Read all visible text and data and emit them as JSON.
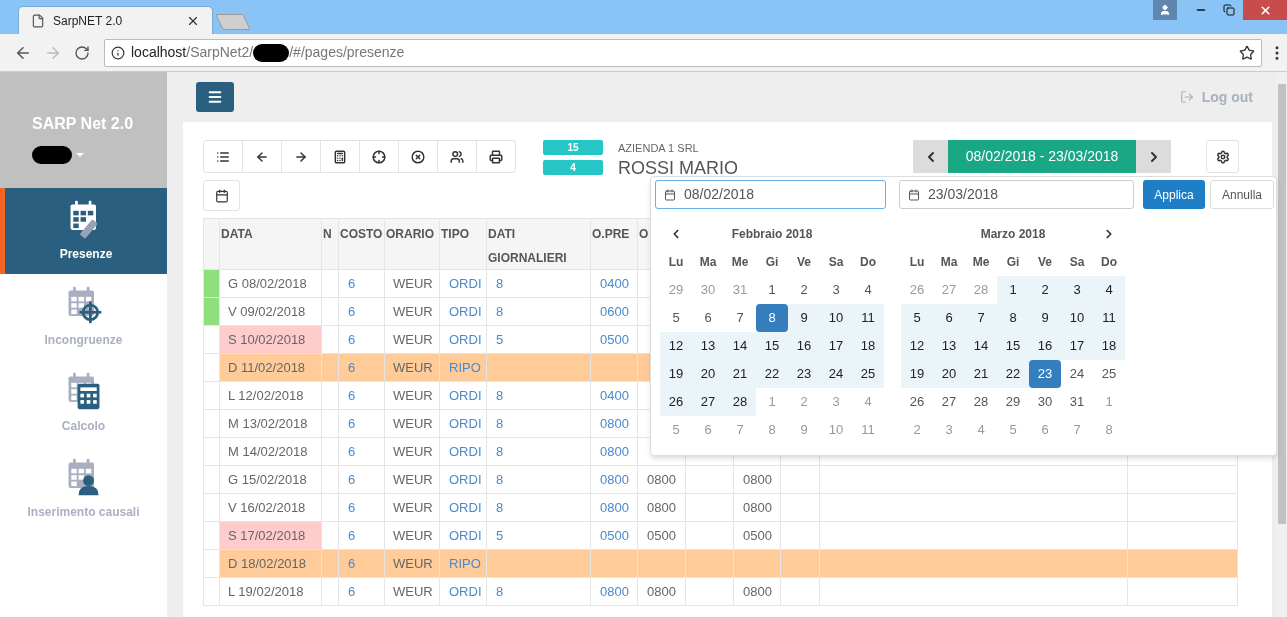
{
  "browser": {
    "tab_title": "SarpNET 2.0",
    "url_host": "localhost",
    "url_path": "/SarpNet2/",
    "url_rest": "/#/pages/presenze"
  },
  "header": {
    "logout": "Log out"
  },
  "sidebar": {
    "app_title": "SARP Net 2.0",
    "items": [
      {
        "label": "Presenze",
        "kind": "pencil",
        "selected": true
      },
      {
        "label": "Incongruenze",
        "kind": "target",
        "selected": false
      },
      {
        "label": "Calcolo",
        "kind": "calculator",
        "selected": false
      },
      {
        "label": "Inserimento causali",
        "kind": "person",
        "selected": false
      }
    ]
  },
  "toolbar": {
    "buttons": [
      {
        "kind": "list"
      },
      {
        "kind": "back"
      },
      {
        "kind": "forward"
      },
      {
        "kind": "calculator"
      },
      {
        "kind": "crosshair"
      },
      {
        "kind": "remove"
      },
      {
        "kind": "users"
      },
      {
        "kind": "print"
      }
    ],
    "extra_button": {
      "kind": "calendar"
    }
  },
  "badges": [
    "15",
    "4"
  ],
  "company": "AZIENDA 1 SRL",
  "employee": "ROSSI MARIO",
  "period": {
    "label": "08/02/2018 - 23/03/2018"
  },
  "table": {
    "columns": [
      "DATA",
      "N",
      "COSTO",
      "ORARIO",
      "TIPO",
      "DATI GIORNALIERI",
      "O.PRE",
      "O"
    ],
    "rows": [
      {
        "marked": true,
        "kind": "weekday",
        "date": "G 08/02/2018",
        "costo": "6",
        "orario": "WEUR",
        "tipo": "ORDI",
        "dati": "8",
        "o_pre": "0400"
      },
      {
        "marked": true,
        "kind": "weekday",
        "date": "V 09/02/2018",
        "costo": "6",
        "orario": "WEUR",
        "tipo": "ORDI",
        "dati": "8",
        "o_pre": "0600"
      },
      {
        "marked": false,
        "kind": "saturday",
        "date": "S 10/02/2018",
        "costo": "6",
        "orario": "WEUR",
        "tipo": "ORDI",
        "dati": "5",
        "o_pre": "0500"
      },
      {
        "marked": false,
        "kind": "sunday",
        "date": "D 11/02/2018",
        "costo": "6",
        "orario": "WEUR",
        "tipo": "RIPO"
      },
      {
        "marked": false,
        "kind": "weekday",
        "date": "L 12/02/2018",
        "costo": "6",
        "orario": "WEUR",
        "tipo": "ORDI",
        "dati": "8",
        "o_pre": "0400"
      },
      {
        "marked": false,
        "kind": "weekday",
        "date": "M 13/02/2018",
        "costo": "6",
        "orario": "WEUR",
        "tipo": "ORDI",
        "dati": "8",
        "o_pre": "0800"
      },
      {
        "marked": false,
        "kind": "weekday",
        "date": "M 14/02/2018",
        "costo": "6",
        "orario": "WEUR",
        "tipo": "ORDI",
        "dati": "8",
        "o_pre": "0800"
      },
      {
        "marked": false,
        "kind": "weekday",
        "date": "G 15/02/2018",
        "costo": "6",
        "orario": "WEUR",
        "tipo": "ORDI",
        "dati": "8",
        "o_pre": "0800",
        "column_9": "0800",
        "column_11": "0800"
      },
      {
        "marked": false,
        "kind": "weekday",
        "date": "V 16/02/2018",
        "costo": "6",
        "orario": "WEUR",
        "tipo": "ORDI",
        "dati": "8",
        "o_pre": "0800",
        "column_9": "0800",
        "column_11": "0800"
      },
      {
        "marked": false,
        "kind": "saturday",
        "date": "S 17/02/2018",
        "costo": "6",
        "orario": "WEUR",
        "tipo": "ORDI",
        "dati": "5",
        "o_pre": "0500",
        "column_9": "0500",
        "column_11": "0500"
      },
      {
        "marked": false,
        "kind": "sunday",
        "date": "D 18/02/2018",
        "costo": "6",
        "orario": "WEUR",
        "tipo": "RIPO"
      },
      {
        "marked": false,
        "kind": "weekday",
        "date": "L 19/02/2018",
        "costo": "6",
        "orario": "WEUR",
        "tipo": "ORDI",
        "dati": "8",
        "o_pre": "0800",
        "column_9": "0800",
        "column_11": "0800"
      }
    ]
  },
  "date_picker": {
    "start": "08/02/2018",
    "start_focused": true,
    "end": "23/03/2018",
    "apply": "Applica",
    "cancel": "Annulla",
    "months": [
      {
        "title": "Febbraio 2018",
        "weekdays": [
          "Lu",
          "Ma",
          "Me",
          "Gi",
          "Ve",
          "Sa",
          "Do"
        ],
        "weeks": [
          [
            {
              "t": "29",
              "off": true,
              "in_range": false,
              "selected": false
            },
            {
              "t": "30",
              "off": true,
              "in_range": false,
              "selected": false
            },
            {
              "t": "31",
              "off": true,
              "in_range": false,
              "selected": false
            },
            {
              "t": "1",
              "off": false,
              "in_range": false,
              "selected": false
            },
            {
              "t": "2",
              "off": false,
              "in_range": false,
              "selected": false
            },
            {
              "t": "3",
              "off": false,
              "in_range": false,
              "selected": false
            },
            {
              "t": "4",
              "off": false,
              "in_range": false,
              "selected": false
            }
          ],
          [
            {
              "t": "5",
              "off": false,
              "in_range": false,
              "selected": false
            },
            {
              "t": "6",
              "off": false,
              "in_range": false,
              "selected": false
            },
            {
              "t": "7",
              "off": false,
              "in_range": false,
              "selected": false
            },
            {
              "t": "8",
              "off": false,
              "in_range": true,
              "selected": true
            },
            {
              "t": "9",
              "off": false,
              "in_range": true,
              "selected": false
            },
            {
              "t": "10",
              "off": false,
              "in_range": true,
              "selected": false
            },
            {
              "t": "11",
              "off": false,
              "in_range": true,
              "selected": false
            }
          ],
          [
            {
              "t": "12",
              "off": false,
              "in_range": true,
              "selected": false
            },
            {
              "t": "13",
              "off": false,
              "in_range": true,
              "selected": false
            },
            {
              "t": "14",
              "off": false,
              "in_range": true,
              "selected": false
            },
            {
              "t": "15",
              "off": false,
              "in_range": true,
              "selected": false
            },
            {
              "t": "16",
              "off": false,
              "in_range": true,
              "selected": false
            },
            {
              "t": "17",
              "off": false,
              "in_range": true,
              "selected": false
            },
            {
              "t": "18",
              "off": false,
              "in_range": true,
              "selected": false
            }
          ],
          [
            {
              "t": "19",
              "off": false,
              "in_range": true,
              "selected": false
            },
            {
              "t": "20",
              "off": false,
              "in_range": true,
              "selected": false
            },
            {
              "t": "21",
              "off": false,
              "in_range": true,
              "selected": false
            },
            {
              "t": "22",
              "off": false,
              "in_range": true,
              "selected": false
            },
            {
              "t": "23",
              "off": false,
              "in_range": true,
              "selected": false
            },
            {
              "t": "24",
              "off": false,
              "in_range": true,
              "selected": false
            },
            {
              "t": "25",
              "off": false,
              "in_range": true,
              "selected": false
            }
          ],
          [
            {
              "t": "26",
              "off": false,
              "in_range": true,
              "selected": false
            },
            {
              "t": "27",
              "off": false,
              "in_range": true,
              "selected": false
            },
            {
              "t": "28",
              "off": false,
              "in_range": true,
              "selected": false
            },
            {
              "t": "1",
              "off": true,
              "in_range": false,
              "selected": false
            },
            {
              "t": "2",
              "off": true,
              "in_range": false,
              "selected": false
            },
            {
              "t": "3",
              "off": true,
              "in_range": false,
              "selected": false
            },
            {
              "t": "4",
              "off": true,
              "in_range": false,
              "selected": false
            }
          ],
          [
            {
              "t": "5",
              "off": true,
              "in_range": false,
              "selected": false
            },
            {
              "t": "6",
              "off": true,
              "in_range": false,
              "selected": false
            },
            {
              "t": "7",
              "off": true,
              "in_range": false,
              "selected": false
            },
            {
              "t": "8",
              "off": true,
              "in_range": false,
              "selected": false
            },
            {
              "t": "9",
              "off": true,
              "in_range": false,
              "selected": false
            },
            {
              "t": "10",
              "off": true,
              "in_range": false,
              "selected": false
            },
            {
              "t": "11",
              "off": true,
              "in_range": false,
              "selected": false
            }
          ]
        ]
      },
      {
        "title": "Marzo 2018",
        "weekdays": [
          "Lu",
          "Ma",
          "Me",
          "Gi",
          "Ve",
          "Sa",
          "Do"
        ],
        "weeks": [
          [
            {
              "t": "26",
              "off": true,
              "in_range": false,
              "selected": false
            },
            {
              "t": "27",
              "off": true,
              "in_range": false,
              "selected": false
            },
            {
              "t": "28",
              "off": true,
              "in_range": false,
              "selected": false
            },
            {
              "t": "1",
              "off": false,
              "in_range": true,
              "selected": false
            },
            {
              "t": "2",
              "off": false,
              "in_range": true,
              "selected": false
            },
            {
              "t": "3",
              "off": false,
              "in_range": true,
              "selected": false
            },
            {
              "t": "4",
              "off": false,
              "in_range": true,
              "selected": false
            }
          ],
          [
            {
              "t": "5",
              "off": false,
              "in_range": true,
              "selected": false
            },
            {
              "t": "6",
              "off": false,
              "in_range": true,
              "selected": false
            },
            {
              "t": "7",
              "off": false,
              "in_range": true,
              "selected": false
            },
            {
              "t": "8",
              "off": false,
              "in_range": true,
              "selected": false
            },
            {
              "t": "9",
              "off": false,
              "in_range": true,
              "selected": false
            },
            {
              "t": "10",
              "off": false,
              "in_range": true,
              "selected": false
            },
            {
              "t": "11",
              "off": false,
              "in_range": true,
              "selected": false
            }
          ],
          [
            {
              "t": "12",
              "off": false,
              "in_range": true,
              "selected": false
            },
            {
              "t": "13",
              "off": false,
              "in_range": true,
              "selected": false
            },
            {
              "t": "14",
              "off": false,
              "in_range": true,
              "selected": false
            },
            {
              "t": "15",
              "off": false,
              "in_range": true,
              "selected": false
            },
            {
              "t": "16",
              "off": false,
              "in_range": true,
              "selected": false
            },
            {
              "t": "17",
              "off": false,
              "in_range": true,
              "selected": false
            },
            {
              "t": "18",
              "off": false,
              "in_range": true,
              "selected": false
            }
          ],
          [
            {
              "t": "19",
              "off": false,
              "in_range": true,
              "selected": false
            },
            {
              "t": "20",
              "off": false,
              "in_range": true,
              "selected": false
            },
            {
              "t": "21",
              "off": false,
              "in_range": true,
              "selected": false
            },
            {
              "t": "22",
              "off": false,
              "in_range": true,
              "selected": false
            },
            {
              "t": "23",
              "off": false,
              "in_range": true,
              "selected": true
            },
            {
              "t": "24",
              "off": false,
              "in_range": false,
              "selected": false
            },
            {
              "t": "25",
              "off": false,
              "in_range": false,
              "selected": false
            }
          ],
          [
            {
              "t": "26",
              "off": false,
              "in_range": false,
              "selected": false
            },
            {
              "t": "27",
              "off": false,
              "in_range": false,
              "selected": false
            },
            {
              "t": "28",
              "off": false,
              "in_range": false,
              "selected": false
            },
            {
              "t": "29",
              "off": false,
              "in_range": false,
              "selected": false
            },
            {
              "t": "30",
              "off": false,
              "in_range": false,
              "selected": false
            },
            {
              "t": "31",
              "off": false,
              "in_range": false,
              "selected": false
            },
            {
              "t": "1",
              "off": true,
              "in_range": false,
              "selected": false
            }
          ],
          [
            {
              "t": "2",
              "off": true,
              "in_range": false,
              "selected": false
            },
            {
              "t": "3",
              "off": true,
              "in_range": false,
              "selected": false
            },
            {
              "t": "4",
              "off": true,
              "in_range": false,
              "selected": false
            },
            {
              "t": "5",
              "off": true,
              "in_range": false,
              "selected": false
            },
            {
              "t": "6",
              "off": true,
              "in_range": false,
              "selected": false
            },
            {
              "t": "7",
              "off": true,
              "in_range": false,
              "selected": false
            },
            {
              "t": "8",
              "off": true,
              "in_range": false,
              "selected": false
            }
          ]
        ]
      }
    ]
  }
}
